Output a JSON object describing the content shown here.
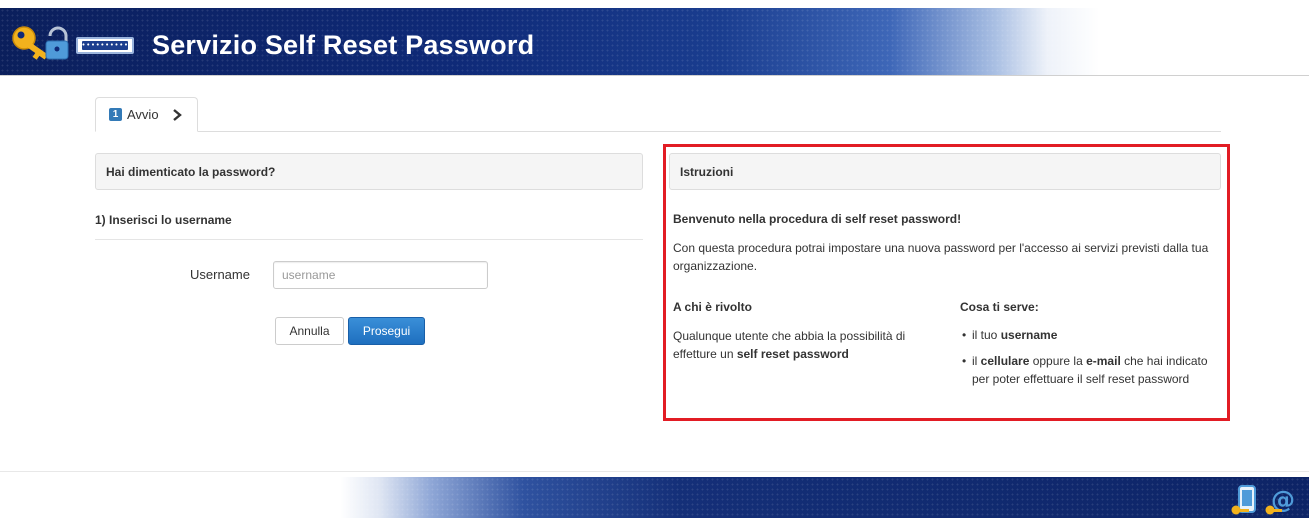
{
  "header": {
    "title": "Servizio Self Reset Password",
    "logo_field_text": "••••••••••"
  },
  "wizard": {
    "step_number": "1",
    "step_label": "Avvio"
  },
  "left_panel": {
    "heading": "Hai dimenticato la password?",
    "subheading": "1) Inserisci lo username",
    "username_label": "Username",
    "username_placeholder": "username",
    "username_value": "",
    "cancel_label": "Annulla",
    "next_label": "Prosegui"
  },
  "right_panel": {
    "heading": "Istruzioni",
    "welcome": "Benvenuto nella procedura di self reset password!",
    "intro": "Con questa procedura potrai impostare una nuova password per l'accesso ai servizi previsti dalla tua organizzazione.",
    "who_heading": "A chi è rivolto",
    "who_text_1": "Qualunque utente che abbia la possibilità di effetture un ",
    "who_text_bold": "self reset password",
    "need_heading": "Cosa ti serve:",
    "need_1_pre": "il tuo ",
    "need_1_bold": "username",
    "need_2_pre": "il ",
    "need_2_bold_1": "cellulare",
    "need_2_mid": " oppure la ",
    "need_2_bold_2": "e-mail",
    "need_2_post": " che hai indicato per poter effettuare il self reset password"
  },
  "colors": {
    "accent_blue": "#337ab7",
    "header_dark_blue": "#0f2a78",
    "highlight_red": "#e21c24",
    "key_gold": "#f2b21d"
  },
  "icons": {
    "logo": "key-lock-icon",
    "tab_chevron": "chevron-right-icon",
    "footer_left": "phone-key-icon",
    "footer_right": "at-sign-key-icon"
  }
}
